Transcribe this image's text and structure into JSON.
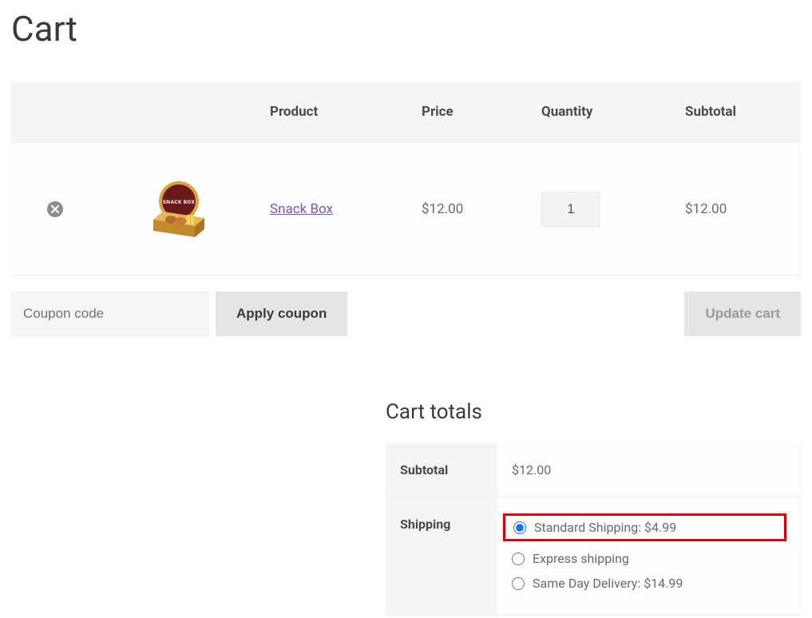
{
  "page": {
    "title": "Cart"
  },
  "cart_table": {
    "headers": {
      "product": "Product",
      "price": "Price",
      "quantity": "Quantity",
      "subtotal": "Subtotal"
    },
    "items": [
      {
        "name": "Snack Box",
        "thumbnail_label": "SNACK BOX",
        "price": "$12.00",
        "quantity": "1",
        "subtotal": "$12.00"
      }
    ]
  },
  "coupon": {
    "placeholder": "Coupon code",
    "apply_label": "Apply coupon"
  },
  "update_cart_label": "Update cart",
  "cart_totals": {
    "title": "Cart totals",
    "subtotal_label": "Subtotal",
    "subtotal_value": "$12.00",
    "shipping_label": "Shipping",
    "shipping_options": [
      {
        "label": "Standard Shipping: $4.99",
        "selected": true
      },
      {
        "label": "Express shipping",
        "selected": false
      },
      {
        "label": "Same Day Delivery: $14.99",
        "selected": false
      }
    ]
  }
}
